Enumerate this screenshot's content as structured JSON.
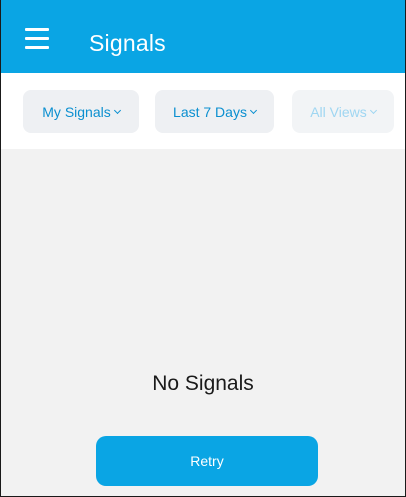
{
  "appbar": {
    "title": "Signals",
    "menu_icon": "hamburger-menu-icon"
  },
  "filters": [
    {
      "label": "My Signals",
      "icon": "chevron-down-icon",
      "state": "active"
    },
    {
      "label": "Last 7 Days",
      "icon": "chevron-down-icon",
      "state": "active"
    },
    {
      "label": "All Views",
      "icon": "chevron-down-icon",
      "state": "disabled"
    }
  ],
  "empty_state": {
    "message": "No Signals",
    "retry_label": "Retry"
  },
  "colors": {
    "accent": "#0aa5e4",
    "chip_background": "#eef0f3",
    "chip_text": "#0a8fd0",
    "page_background": "#f2f2f2"
  }
}
